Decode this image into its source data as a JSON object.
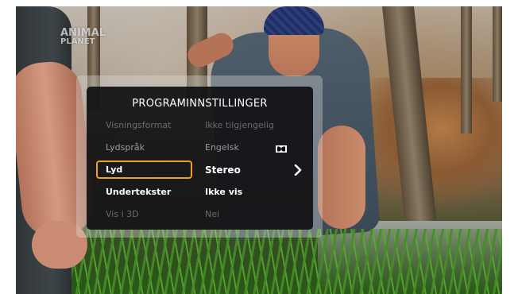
{
  "channel_logo": {
    "line1": "ANIMAL",
    "line2": "PLANET"
  },
  "menu": {
    "title": "PROGRAMINNSTILLINGER",
    "rows": [
      {
        "label": "Visningsformat",
        "value": "Ikke tilgjengelig",
        "state": "disabled"
      },
      {
        "label": "Lydspråk",
        "value": "Engelsk",
        "state": "normal",
        "value_icon": "dolby-icon"
      },
      {
        "label": "Lyd",
        "value": "Stereo",
        "state": "selected",
        "value_icon": "chevron-right-icon"
      },
      {
        "label": "Undertekster",
        "value": "Ikke vis",
        "state": "normal"
      },
      {
        "label": "Vis i 3D",
        "value": "Nei",
        "state": "disabled"
      }
    ]
  },
  "colors": {
    "highlight": "#f0a020",
    "panel": "#0c0c0e",
    "text": "#ffffff"
  }
}
